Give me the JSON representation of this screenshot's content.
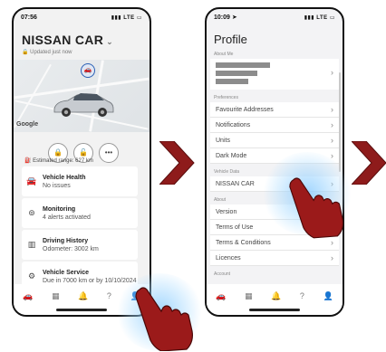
{
  "phone1": {
    "status_time": "07:56",
    "status_net": "LTE",
    "car_name": "NISSAN CAR",
    "updated": "Updated just now",
    "map_label": "Google",
    "range_label": "Estimated range: 627 km",
    "cards": [
      {
        "title": "Vehicle Health",
        "subtitle": "No issues"
      },
      {
        "title": "Monitoring",
        "subtitle": "4 alerts activated"
      },
      {
        "title": "Driving History",
        "subtitle": "Odometer: 3002 km"
      },
      {
        "title": "Vehicle Service",
        "subtitle": "Due in 7000 km or by 10/10/2024"
      }
    ]
  },
  "phone2": {
    "status_time": "10:09",
    "status_net": "LTE",
    "title": "Profile",
    "about_me": "About Me",
    "preferences_header": "Preferences",
    "preferences": [
      "Favourite Addresses",
      "Notifications",
      "Units",
      "Dark Mode"
    ],
    "vehicle_data_header": "Vehicle Data",
    "vehicle_item": "NISSAN CAR",
    "about_header": "About",
    "about_items": [
      "Version",
      "Terms of Use",
      "Terms & Conditions",
      "Licences"
    ],
    "account_header": "Account"
  },
  "colors": {
    "accent": "#1e3d7a",
    "arrow": "#8e1b1b"
  }
}
